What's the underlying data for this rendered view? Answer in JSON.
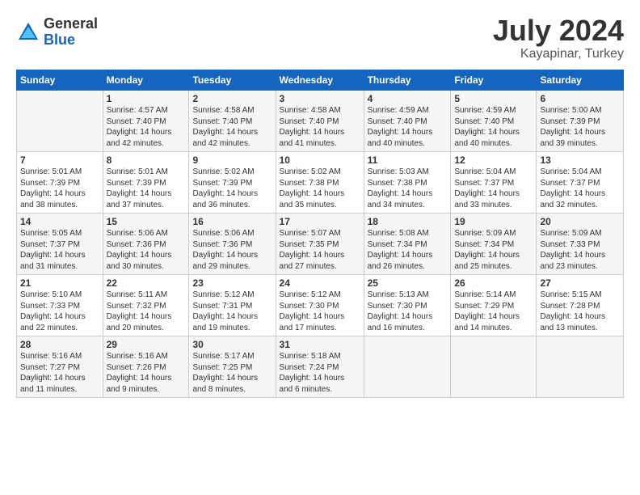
{
  "logo": {
    "general": "General",
    "blue": "Blue"
  },
  "title": "July 2024",
  "subtitle": "Kayapinar, Turkey",
  "days_header": [
    "Sunday",
    "Monday",
    "Tuesday",
    "Wednesday",
    "Thursday",
    "Friday",
    "Saturday"
  ],
  "weeks": [
    [
      {
        "day": "",
        "sunrise": "",
        "sunset": "",
        "daylight": ""
      },
      {
        "day": "1",
        "sunrise": "Sunrise: 4:57 AM",
        "sunset": "Sunset: 7:40 PM",
        "daylight": "Daylight: 14 hours and 42 minutes."
      },
      {
        "day": "2",
        "sunrise": "Sunrise: 4:58 AM",
        "sunset": "Sunset: 7:40 PM",
        "daylight": "Daylight: 14 hours and 42 minutes."
      },
      {
        "day": "3",
        "sunrise": "Sunrise: 4:58 AM",
        "sunset": "Sunset: 7:40 PM",
        "daylight": "Daylight: 14 hours and 41 minutes."
      },
      {
        "day": "4",
        "sunrise": "Sunrise: 4:59 AM",
        "sunset": "Sunset: 7:40 PM",
        "daylight": "Daylight: 14 hours and 40 minutes."
      },
      {
        "day": "5",
        "sunrise": "Sunrise: 4:59 AM",
        "sunset": "Sunset: 7:40 PM",
        "daylight": "Daylight: 14 hours and 40 minutes."
      },
      {
        "day": "6",
        "sunrise": "Sunrise: 5:00 AM",
        "sunset": "Sunset: 7:39 PM",
        "daylight": "Daylight: 14 hours and 39 minutes."
      }
    ],
    [
      {
        "day": "7",
        "sunrise": "Sunrise: 5:01 AM",
        "sunset": "Sunset: 7:39 PM",
        "daylight": "Daylight: 14 hours and 38 minutes."
      },
      {
        "day": "8",
        "sunrise": "Sunrise: 5:01 AM",
        "sunset": "Sunset: 7:39 PM",
        "daylight": "Daylight: 14 hours and 37 minutes."
      },
      {
        "day": "9",
        "sunrise": "Sunrise: 5:02 AM",
        "sunset": "Sunset: 7:39 PM",
        "daylight": "Daylight: 14 hours and 36 minutes."
      },
      {
        "day": "10",
        "sunrise": "Sunrise: 5:02 AM",
        "sunset": "Sunset: 7:38 PM",
        "daylight": "Daylight: 14 hours and 35 minutes."
      },
      {
        "day": "11",
        "sunrise": "Sunrise: 5:03 AM",
        "sunset": "Sunset: 7:38 PM",
        "daylight": "Daylight: 14 hours and 34 minutes."
      },
      {
        "day": "12",
        "sunrise": "Sunrise: 5:04 AM",
        "sunset": "Sunset: 7:37 PM",
        "daylight": "Daylight: 14 hours and 33 minutes."
      },
      {
        "day": "13",
        "sunrise": "Sunrise: 5:04 AM",
        "sunset": "Sunset: 7:37 PM",
        "daylight": "Daylight: 14 hours and 32 minutes."
      }
    ],
    [
      {
        "day": "14",
        "sunrise": "Sunrise: 5:05 AM",
        "sunset": "Sunset: 7:37 PM",
        "daylight": "Daylight: 14 hours and 31 minutes."
      },
      {
        "day": "15",
        "sunrise": "Sunrise: 5:06 AM",
        "sunset": "Sunset: 7:36 PM",
        "daylight": "Daylight: 14 hours and 30 minutes."
      },
      {
        "day": "16",
        "sunrise": "Sunrise: 5:06 AM",
        "sunset": "Sunset: 7:36 PM",
        "daylight": "Daylight: 14 hours and 29 minutes."
      },
      {
        "day": "17",
        "sunrise": "Sunrise: 5:07 AM",
        "sunset": "Sunset: 7:35 PM",
        "daylight": "Daylight: 14 hours and 27 minutes."
      },
      {
        "day": "18",
        "sunrise": "Sunrise: 5:08 AM",
        "sunset": "Sunset: 7:34 PM",
        "daylight": "Daylight: 14 hours and 26 minutes."
      },
      {
        "day": "19",
        "sunrise": "Sunrise: 5:09 AM",
        "sunset": "Sunset: 7:34 PM",
        "daylight": "Daylight: 14 hours and 25 minutes."
      },
      {
        "day": "20",
        "sunrise": "Sunrise: 5:09 AM",
        "sunset": "Sunset: 7:33 PM",
        "daylight": "Daylight: 14 hours and 23 minutes."
      }
    ],
    [
      {
        "day": "21",
        "sunrise": "Sunrise: 5:10 AM",
        "sunset": "Sunset: 7:33 PM",
        "daylight": "Daylight: 14 hours and 22 minutes."
      },
      {
        "day": "22",
        "sunrise": "Sunrise: 5:11 AM",
        "sunset": "Sunset: 7:32 PM",
        "daylight": "Daylight: 14 hours and 20 minutes."
      },
      {
        "day": "23",
        "sunrise": "Sunrise: 5:12 AM",
        "sunset": "Sunset: 7:31 PM",
        "daylight": "Daylight: 14 hours and 19 minutes."
      },
      {
        "day": "24",
        "sunrise": "Sunrise: 5:12 AM",
        "sunset": "Sunset: 7:30 PM",
        "daylight": "Daylight: 14 hours and 17 minutes."
      },
      {
        "day": "25",
        "sunrise": "Sunrise: 5:13 AM",
        "sunset": "Sunset: 7:30 PM",
        "daylight": "Daylight: 14 hours and 16 minutes."
      },
      {
        "day": "26",
        "sunrise": "Sunrise: 5:14 AM",
        "sunset": "Sunset: 7:29 PM",
        "daylight": "Daylight: 14 hours and 14 minutes."
      },
      {
        "day": "27",
        "sunrise": "Sunrise: 5:15 AM",
        "sunset": "Sunset: 7:28 PM",
        "daylight": "Daylight: 14 hours and 13 minutes."
      }
    ],
    [
      {
        "day": "28",
        "sunrise": "Sunrise: 5:16 AM",
        "sunset": "Sunset: 7:27 PM",
        "daylight": "Daylight: 14 hours and 11 minutes."
      },
      {
        "day": "29",
        "sunrise": "Sunrise: 5:16 AM",
        "sunset": "Sunset: 7:26 PM",
        "daylight": "Daylight: 14 hours and 9 minutes."
      },
      {
        "day": "30",
        "sunrise": "Sunrise: 5:17 AM",
        "sunset": "Sunset: 7:25 PM",
        "daylight": "Daylight: 14 hours and 8 minutes."
      },
      {
        "day": "31",
        "sunrise": "Sunrise: 5:18 AM",
        "sunset": "Sunset: 7:24 PM",
        "daylight": "Daylight: 14 hours and 6 minutes."
      },
      {
        "day": "",
        "sunrise": "",
        "sunset": "",
        "daylight": ""
      },
      {
        "day": "",
        "sunrise": "",
        "sunset": "",
        "daylight": ""
      },
      {
        "day": "",
        "sunrise": "",
        "sunset": "",
        "daylight": ""
      }
    ]
  ]
}
